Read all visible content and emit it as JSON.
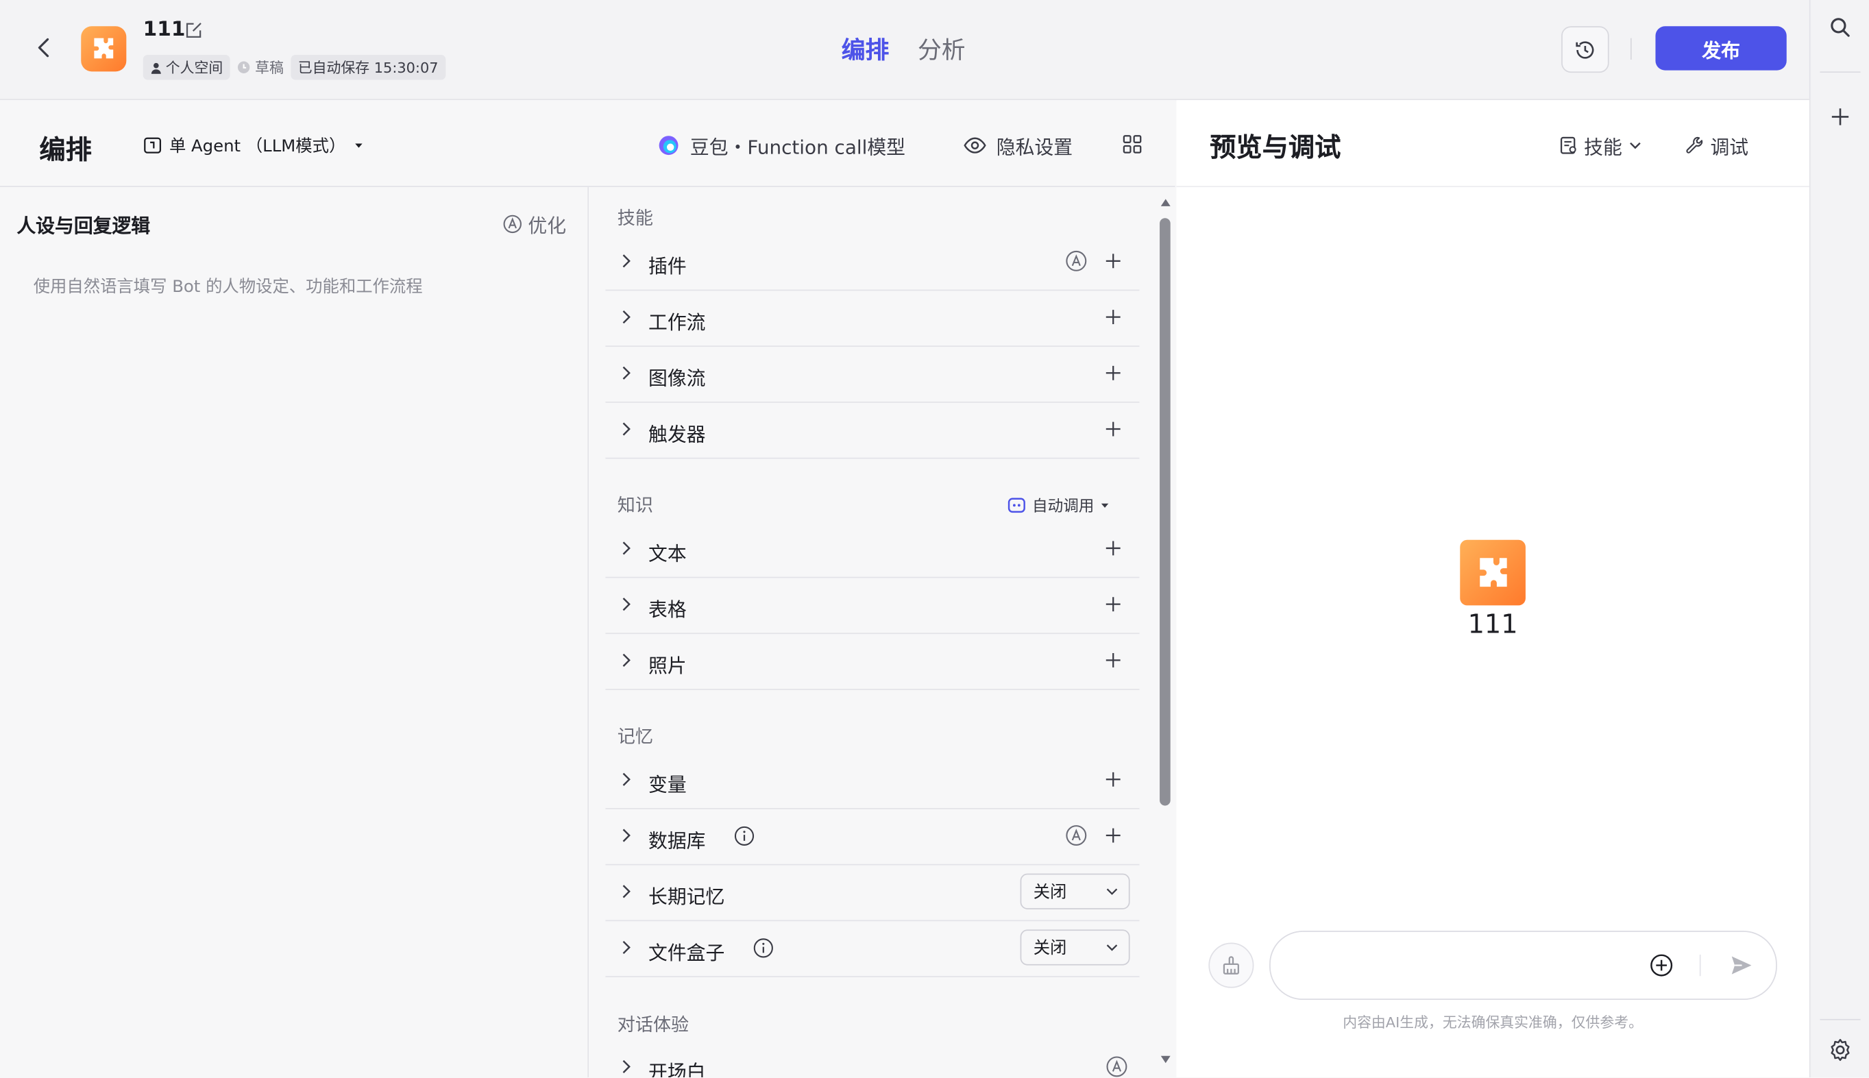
{
  "header": {
    "bot_name": "111",
    "workspace_chip": "个人空间",
    "draft_label": "草稿",
    "autosave_label": "已自动保存 15:30:07",
    "tabs": [
      {
        "label": "编排",
        "active": true
      },
      {
        "label": "分析",
        "active": false
      }
    ],
    "publish_label": "发布"
  },
  "toolbar": {
    "title": "编排",
    "agent_mode": "单 Agent （LLM模式）",
    "model_label": "豆包・Function call模型",
    "privacy_label": "隐私设置"
  },
  "persona": {
    "title": "人设与回复逻辑",
    "optimize_label": "优化",
    "placeholder": "使用自然语言填写 Bot 的人物设定、功能和工作流程"
  },
  "skills": {
    "skills_section": {
      "title": "技能",
      "items": [
        "插件",
        "工作流",
        "图像流",
        "触发器"
      ]
    },
    "knowledge_section": {
      "title": "知识",
      "auto_call_label": "自动调用",
      "items": [
        "文本",
        "表格",
        "照片"
      ]
    },
    "memory_section": {
      "title": "记忆",
      "items": [
        "变量",
        "数据库",
        "长期记忆",
        "文件盒子"
      ],
      "long_term_memory_value": "关闭",
      "file_box_value": "关闭"
    },
    "dialog_section": {
      "title": "对话体验",
      "items": [
        "开场白"
      ]
    }
  },
  "preview": {
    "title": "预览与调试",
    "skill_label": "技能",
    "debug_label": "调试",
    "bot_name": "111",
    "input_placeholder": "",
    "disclaimer": "内容由AI生成，无法确保真实准确，仅供参考。"
  },
  "colors": {
    "accent": "#4d53e8",
    "avatar_gradient_start": "#ffb057",
    "avatar_gradient_end": "#ff7a2c"
  }
}
